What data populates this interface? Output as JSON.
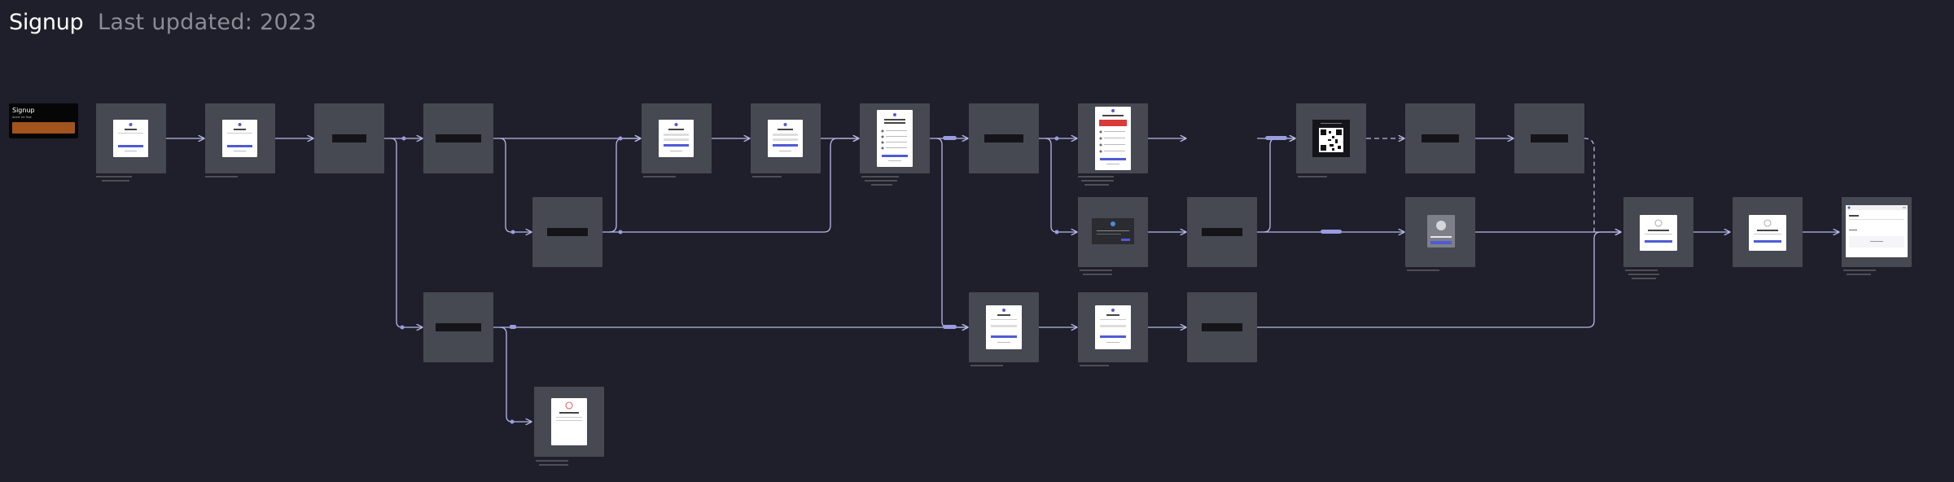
{
  "page": {
    "title": "Signup",
    "subtitle": "Last updated: 2023"
  },
  "start": {
    "title": "Signup",
    "subtitle": "Acme Inc flow"
  },
  "colors": {
    "background": "#1e1f2b",
    "frame": "#464852",
    "wire": "#b9b9e6",
    "accent_button": "#4e5bd6",
    "note_bar": "#a2541f"
  }
}
